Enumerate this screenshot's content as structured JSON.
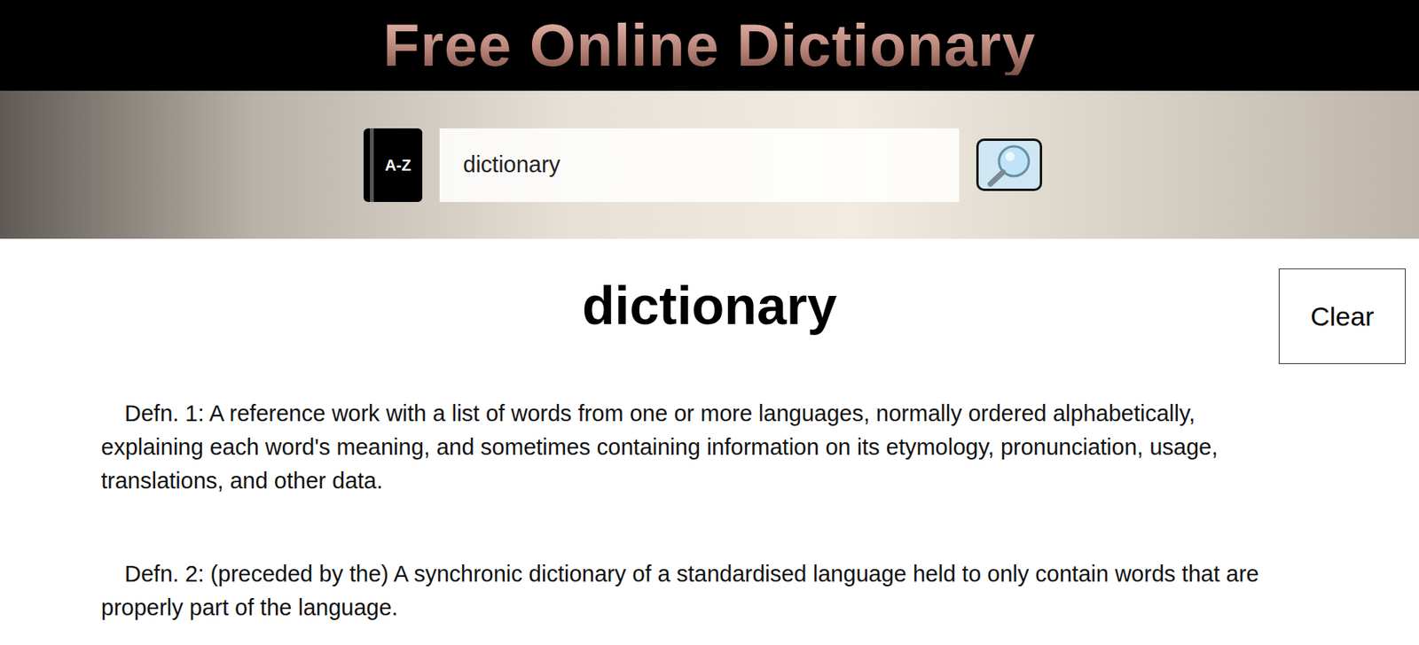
{
  "header": {
    "title": "Free Online Dictionary"
  },
  "search": {
    "icon_label": "A-Z",
    "value": "dictionary"
  },
  "entry": {
    "word": "dictionary",
    "clear_button": "Clear",
    "definitions": [
      {
        "text": "Defn. 1: A reference work with a list of words from one or more languages, normally ordered alphabetically, explaining each word's meaning, and sometimes containing information on its etymology, pronunciation, usage, translations, and other data."
      },
      {
        "text": "Defn. 2: (preceded by the) A synchronic dictionary of a standardised language held to only contain words that are properly part of the language."
      }
    ]
  }
}
